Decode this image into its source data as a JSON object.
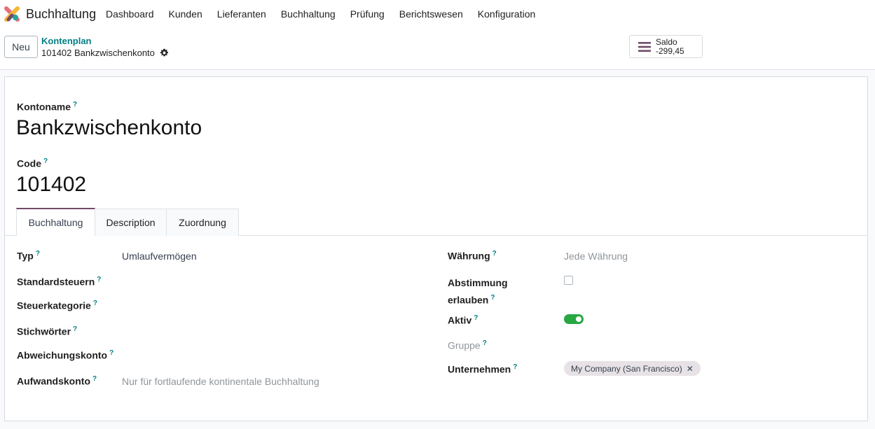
{
  "navbar": {
    "app_name": "Buchhaltung",
    "menu": [
      "Dashboard",
      "Kunden",
      "Lieferanten",
      "Buchhaltung",
      "Prüfung",
      "Berichtswesen",
      "Konfiguration"
    ]
  },
  "control": {
    "new_label": "Neu",
    "breadcrumb": "Kontenplan",
    "record_title": "101402 Bankzwischenkonto",
    "saldo_label": "Saldo",
    "saldo_value": "-299,45"
  },
  "form": {
    "help_mark": "?",
    "account_name_label": "Kontoname",
    "account_name": "Bankzwischenkonto",
    "code_label": "Code",
    "code": "101402",
    "tabs": [
      "Buchhaltung",
      "Description",
      "Zuordnung"
    ],
    "left": {
      "typ_label": "Typ",
      "typ_value": "Umlaufvermögen",
      "standardsteuern_label": "Standardsteuern",
      "steuerkategorie_label": "Steuerkategorie",
      "stichwoerter_label": "Stichwörter",
      "abweichungskonto_label": "Abweichungskonto",
      "aufwandskonto_label": "Aufwandskonto",
      "aufwandskonto_placeholder": "Nur für fortlaufende kontinentale Buchhaltung"
    },
    "right": {
      "waehrung_label": "Währung",
      "waehrung_placeholder": "Jede Währung",
      "abstimmung_label_1": "Abstimmung",
      "abstimmung_label_2": "erlauben",
      "aktiv_label": "Aktiv",
      "aktiv": true,
      "gruppe_label": "Gruppe",
      "unternehmen_label": "Unternehmen",
      "unternehmen_tag": "My Company (San Francisco)"
    }
  },
  "colors": {
    "brand": "#714b67",
    "accent": "#017e84",
    "toggle_on": "#28a745"
  }
}
